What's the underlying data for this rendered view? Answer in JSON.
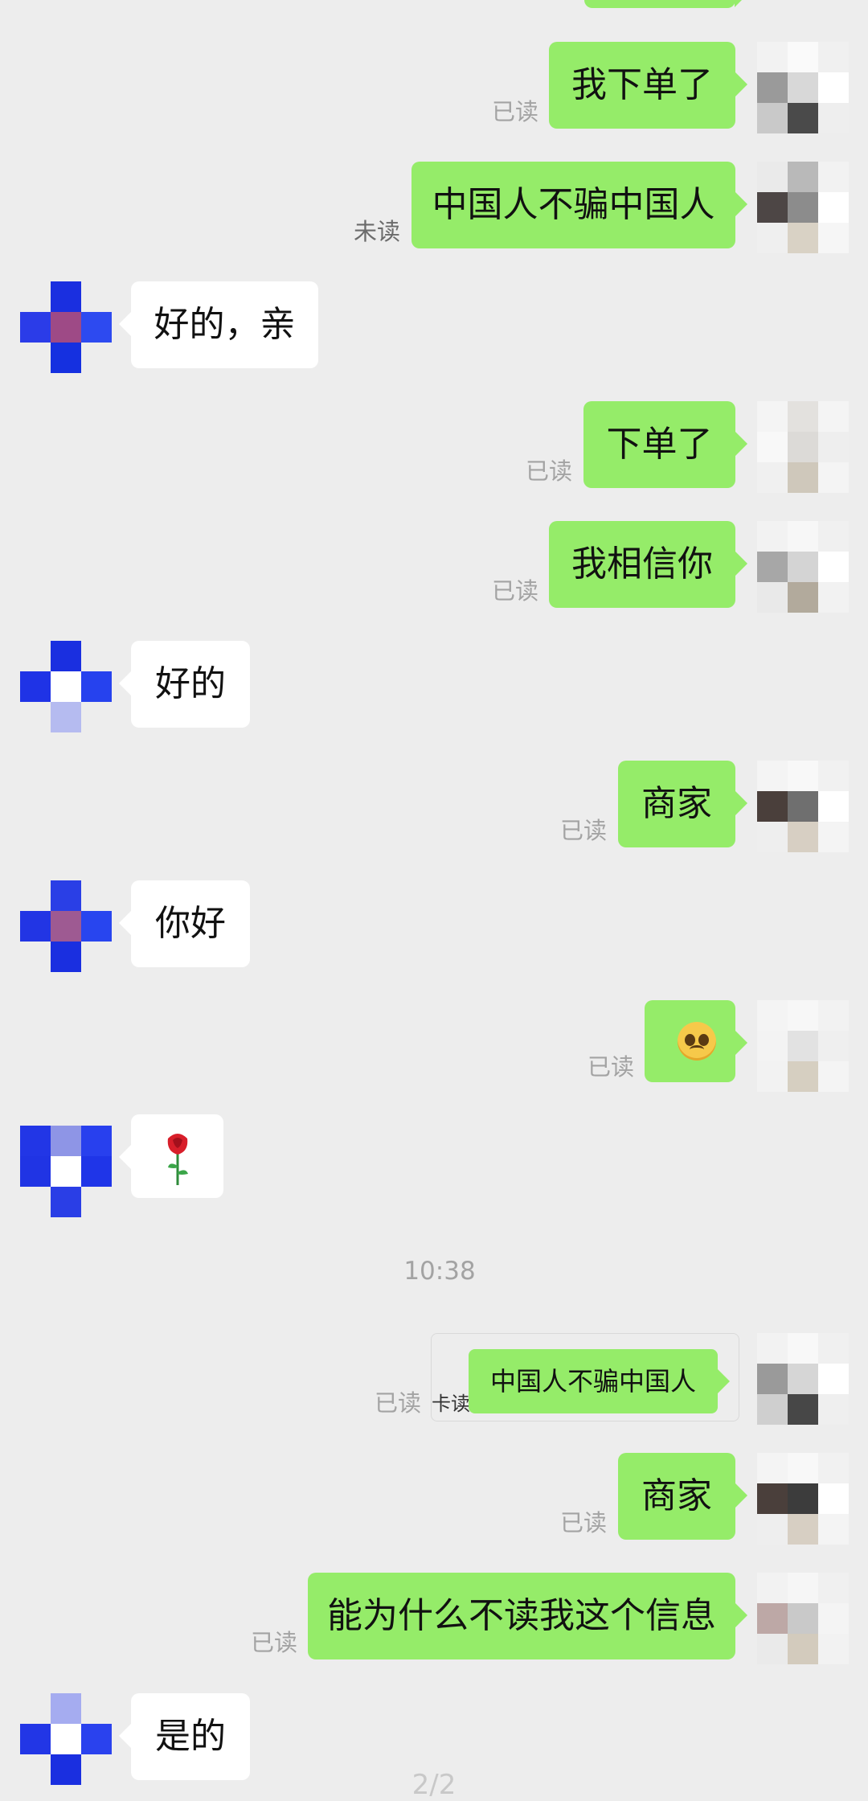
{
  "chat": {
    "read_label": "已读",
    "unread_label": "未读",
    "timestamp": "10:38",
    "page_indicator": "2/2",
    "messages": [
      {
        "text": "我下单了",
        "status": "已读"
      },
      {
        "text": "中国人不骗中国人",
        "status": "未读"
      },
      {
        "text": "好的，亲"
      },
      {
        "text": "下单了",
        "status": "已读"
      },
      {
        "text": "我相信你",
        "status": "已读"
      },
      {
        "text": "好的"
      },
      {
        "text": "商家",
        "status": "已读"
      },
      {
        "text": "你好"
      },
      {
        "emoji": "pleading-face-emoji",
        "status": "已读"
      },
      {
        "emoji": "rose-emoji"
      },
      {
        "text": "中国人不骗中国人",
        "status": "已读",
        "quoted_status_fragment": "卡读",
        "quoted": true
      },
      {
        "text": "商家",
        "status": "已读"
      },
      {
        "text": "能为什么不读我这个信息",
        "status": "已读"
      },
      {
        "text": "是的"
      }
    ]
  },
  "colors": {
    "background": "#ededed",
    "sent_bubble": "#95ec69",
    "received_bubble": "#ffffff",
    "status_text": "#a3a3a3"
  }
}
